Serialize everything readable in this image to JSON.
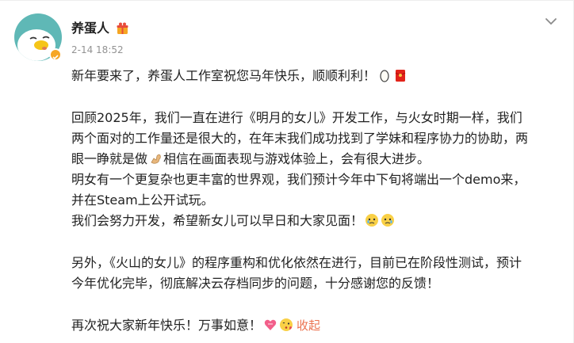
{
  "post": {
    "author": "养蛋人",
    "time": "2-14 18:52",
    "lines": {
      "l1": "新年要来了，养蛋人工作室祝您马年快乐，顺顺利利！",
      "l2": "回顾2025年，我们一直在进行《明月的女儿》开发工作，与火女时期一样，我们",
      "l3": "两个面对的工作量还是很大的，在年末我们成功找到了学妹和程序协力的协助，两",
      "l4a": "眼一睁就是做",
      "l4b": "相信在画面表现与游戏体验上，会有很大进步。",
      "l5": "明女有一个更复杂也更丰富的世界观，我们预计今年中下旬将端出一个demo来，",
      "l6": "并在Steam上公开试玩。",
      "l7": "我们会努力开发，希望新女儿可以早日和大家见面！",
      "l8": "另外，《火山的女儿》的程序重构和优化依然在进行，目前已在阶段性测试，预计",
      "l9": "今年优化完毕，彻底解决云存档同步的问题，十分感谢您的反馈！",
      "l10": "再次祝大家新年快乐！万事如意！"
    },
    "collapse_label": "收起"
  },
  "icons": {
    "avatar": "cartoon-egg-avatar",
    "verified": "verified-badge-icon",
    "user_badge": "gift-badge-icon",
    "more": "chevron-down-icon",
    "emojis": [
      "egg-icon",
      "red-envelope-icon",
      "flexed-arm-icon",
      "crying-face-icon",
      "crying-face-icon",
      "heart-ribbon-icon",
      "kissing-face-icon"
    ]
  },
  "colors": {
    "link": "#eb7350",
    "meta": "#939393",
    "text": "#222222",
    "avatar_bg": "#5fb8b6"
  }
}
